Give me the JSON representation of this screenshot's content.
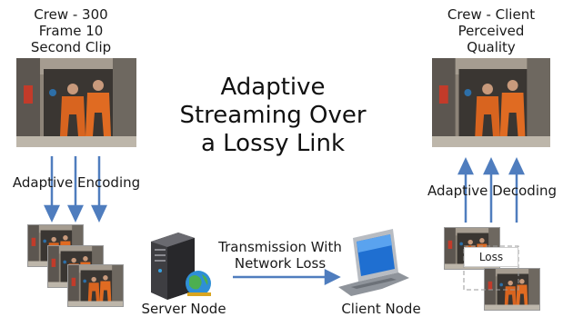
{
  "left_caption": {
    "lines": [
      "Crew - 300",
      "Frame 10",
      "Second Clip"
    ]
  },
  "right_caption": {
    "lines": [
      "Crew - Client",
      "Perceived",
      "Quality"
    ]
  },
  "title": {
    "lines": [
      "Adaptive",
      "Streaming Over",
      "a Lossy Link"
    ]
  },
  "left_arrows_label": "Adaptive Encoding",
  "right_arrows_label": "Adaptive Decoding",
  "transmission_label": {
    "lines": [
      "Transmission With",
      "Network Loss"
    ]
  },
  "server_label": "Server Node",
  "client_label": "Client Node",
  "loss_label": "Loss",
  "colors": {
    "arrow": "#4f7dbe",
    "suit": "#d8641f",
    "wall": "#8d8478",
    "dark": "#2c2a28"
  }
}
